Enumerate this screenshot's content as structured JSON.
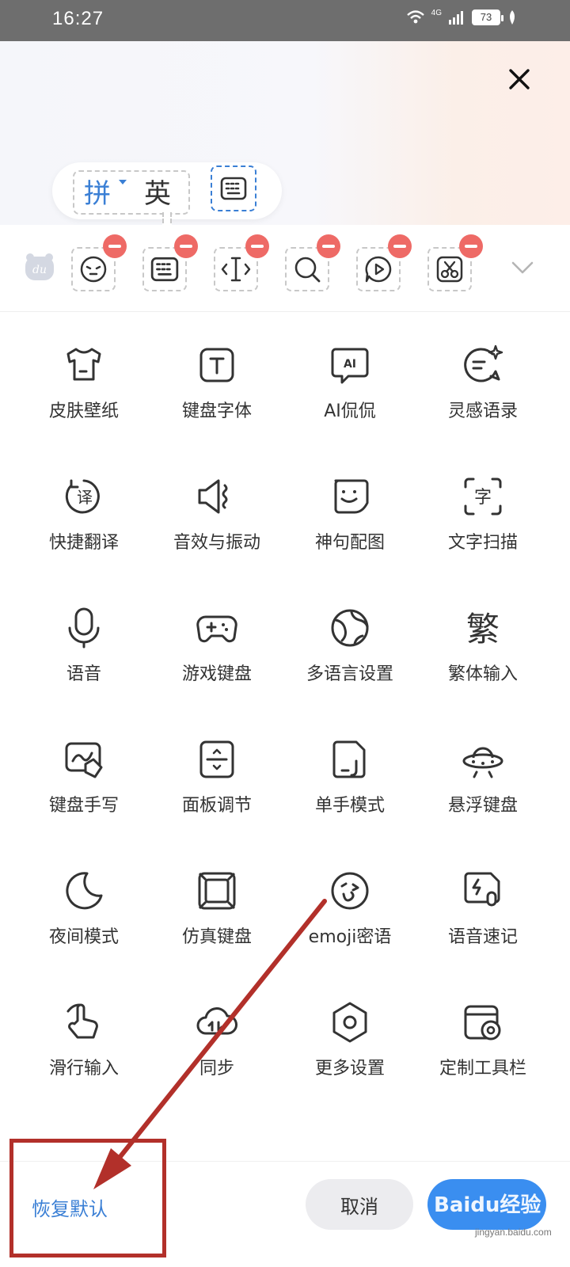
{
  "status_bar": {
    "time": "16:27",
    "network": "4G",
    "battery": "73",
    "icons": [
      "wifi-icon",
      "signal-icon",
      "battery-icon",
      "leaf-icon"
    ]
  },
  "header": {
    "close_icon": "close-icon",
    "lang_pinyin": "拼",
    "lang_english": "英",
    "keyboard_icon": "keyboard-icon"
  },
  "toolbar": {
    "logo_text": "du",
    "slots": [
      {
        "icon": "emoji-face-icon"
      },
      {
        "icon": "keyboard-icon"
      },
      {
        "icon": "cursor-icon"
      },
      {
        "icon": "search-icon"
      },
      {
        "icon": "video-chat-icon"
      },
      {
        "icon": "scissors-icon"
      }
    ],
    "expand_icon": "chevron-down-icon"
  },
  "grid": {
    "items": [
      {
        "label": "皮肤壁纸",
        "icon": "tshirt-icon"
      },
      {
        "label": "键盘字体",
        "icon": "font-icon"
      },
      {
        "label": "AI侃侃",
        "icon": "ai-chat-icon"
      },
      {
        "label": "灵感语录",
        "icon": "sparkle-chat-icon"
      },
      {
        "label": "快捷翻译",
        "icon": "translate-icon"
      },
      {
        "label": "音效与振动",
        "icon": "speaker-vibrate-icon"
      },
      {
        "label": "神句配图",
        "icon": "smile-sticker-icon"
      },
      {
        "label": "文字扫描",
        "icon": "scan-text-icon"
      },
      {
        "label": "语音",
        "icon": "microphone-icon"
      },
      {
        "label": "游戏键盘",
        "icon": "gamepad-icon"
      },
      {
        "label": "多语言设置",
        "icon": "globe-icon"
      },
      {
        "label": "繁体输入",
        "icon": "traditional-char-icon"
      },
      {
        "label": "键盘手写",
        "icon": "handwrite-icon"
      },
      {
        "label": "面板调节",
        "icon": "panel-adjust-icon"
      },
      {
        "label": "单手模式",
        "icon": "one-hand-icon"
      },
      {
        "label": "悬浮键盘",
        "icon": "ufo-icon"
      },
      {
        "label": "夜间模式",
        "icon": "moon-icon"
      },
      {
        "label": "仿真键盘",
        "icon": "key-cap-icon"
      },
      {
        "label": "emoji密语",
        "icon": "wink-icon"
      },
      {
        "label": "语音速记",
        "icon": "voice-note-icon"
      },
      {
        "label": "滑行输入",
        "icon": "swipe-hand-icon"
      },
      {
        "label": "同步",
        "icon": "cloud-sync-icon"
      },
      {
        "label": "更多设置",
        "icon": "settings-hex-icon"
      },
      {
        "label": "定制工具栏",
        "icon": "custom-toolbar-icon"
      }
    ]
  },
  "bottom": {
    "restore_label": "恢复默认",
    "cancel_label": "取消",
    "watermark": "Baidu经验",
    "watermark_sub": "jingyan.baidu.com"
  },
  "colors": {
    "accent": "#3a7fd5",
    "confirm": "#3a8ef0",
    "remove_badge": "#ee6a66",
    "annotation": "#b2302a"
  }
}
